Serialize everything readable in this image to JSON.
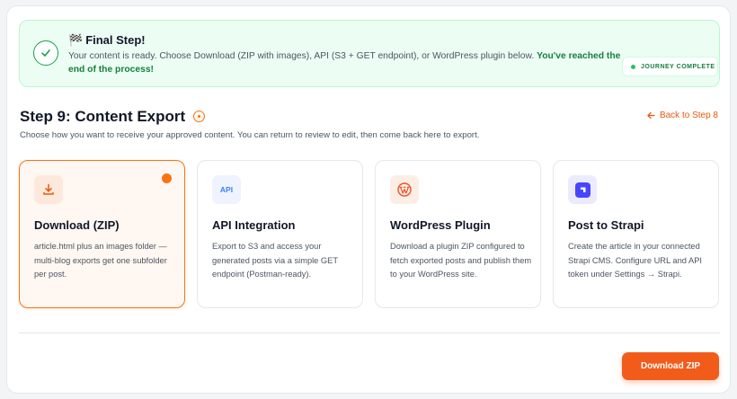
{
  "banner": {
    "icon": "check-circle-icon",
    "flag": "🏁",
    "title": "Final Step!",
    "text": "Your content is ready. Choose Download (ZIP with images), API (S3 + GET endpoint), or WordPress plugin below. ",
    "highlight": "You've reached the end of the process!",
    "badge": "JOURNEY COMPLETE"
  },
  "step": {
    "title": "Step 9: Content Export",
    "subtitle": "Choose how you want to receive your approved content. You can return to review to edit, then come back here to export.",
    "back_label": "Back to Step 8"
  },
  "options": [
    {
      "icon": "download-icon",
      "title": "Download (ZIP)",
      "description": "article.html plus an images folder —multi-blog exports get one subfolder per post.",
      "selected": true
    },
    {
      "icon": "api-icon",
      "icon_text": "API",
      "title": "API Integration",
      "description": "Export to S3 and access your generated posts via a simple GET endpoint (Postman-ready).",
      "selected": false
    },
    {
      "icon": "wordpress-icon",
      "title": "WordPress Plugin",
      "description": "Download a plugin ZIP configured to fetch exported posts and publish them to your WordPress site.",
      "selected": false
    },
    {
      "icon": "strapi-icon",
      "title": "Post to Strapi",
      "description": "Create the article in your connected Strapi CMS. Configure URL and API token under Settings → Strapi.",
      "selected": false
    }
  ],
  "action": {
    "label": "Download ZIP"
  },
  "colors": {
    "accent": "#f25c1b",
    "success": "#15803d",
    "banner_bg": "#ecfdf3"
  }
}
